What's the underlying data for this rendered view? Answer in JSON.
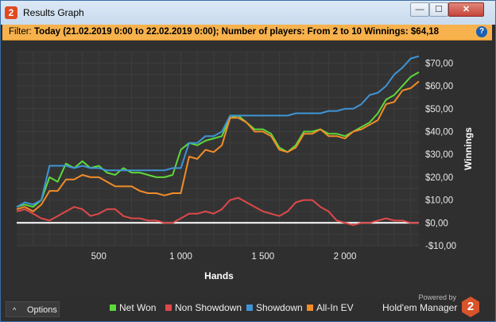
{
  "window": {
    "title": "Results Graph",
    "app_icon_label": "2",
    "minimize": "—",
    "maximize": "☐",
    "close": "✕"
  },
  "filter": {
    "label": "Filter:",
    "text": "Today (21.02.2019 0:00 to 22.02.2019 0:00); Number of players: From 2 to 10  Winnings: $64,18",
    "help": "?"
  },
  "chart_data": {
    "type": "line",
    "xlabel": "Hands",
    "ylabel": "Winnings",
    "xlim": [
      0,
      2450
    ],
    "ylim": [
      -10,
      75
    ],
    "x_ticks": [
      500,
      1000,
      1500,
      2000
    ],
    "x_tick_labels": [
      "500",
      "1 000",
      "1 500",
      "2 000"
    ],
    "y_ticks": [
      -10,
      0,
      10,
      20,
      30,
      40,
      50,
      60,
      70
    ],
    "y_tick_labels": [
      "-$10,00",
      "$0,00",
      "$10,00",
      "$20,00",
      "$30,00",
      "$40,00",
      "$50,00",
      "$60,00",
      "$70,00"
    ],
    "grid": true,
    "x": [
      0,
      50,
      100,
      150,
      200,
      250,
      300,
      350,
      400,
      450,
      500,
      550,
      600,
      650,
      700,
      750,
      800,
      850,
      900,
      950,
      1000,
      1050,
      1100,
      1150,
      1200,
      1250,
      1300,
      1350,
      1400,
      1450,
      1500,
      1550,
      1600,
      1650,
      1700,
      1750,
      1800,
      1850,
      1900,
      1950,
      2000,
      2050,
      2100,
      2150,
      2200,
      2250,
      2300,
      2350,
      2400,
      2450
    ],
    "series": [
      {
        "name": "Net Won",
        "color": "#5dd93a",
        "values": [
          7,
          8,
          7,
          10,
          20,
          18,
          26,
          24,
          27,
          24,
          25,
          22,
          21,
          24,
          22,
          22,
          21,
          20,
          20,
          21,
          32,
          35,
          34,
          36,
          37,
          38,
          46,
          47,
          44,
          41,
          41,
          39,
          33,
          31,
          34,
          40,
          40,
          41,
          39,
          39,
          38,
          40,
          42,
          44,
          48,
          54,
          56,
          60,
          64,
          66
        ]
      },
      {
        "name": "Non Showdown",
        "color": "#e0484a",
        "values": [
          5,
          6,
          4,
          2,
          1,
          3,
          5,
          7,
          6,
          3,
          4,
          6,
          6,
          3,
          2,
          2,
          1,
          1,
          0,
          0,
          2,
          4,
          4,
          5,
          4,
          6,
          10,
          11,
          9,
          7,
          5,
          4,
          3,
          5,
          9,
          10,
          10,
          7,
          5,
          1,
          0,
          -1,
          0,
          0,
          1,
          2,
          1,
          1,
          0,
          0
        ]
      },
      {
        "name": "Showdown",
        "color": "#3f94d6",
        "values": [
          7,
          9,
          8,
          10,
          25,
          25,
          25,
          24,
          25,
          24,
          24,
          23,
          23,
          23,
          23,
          23,
          23,
          23,
          23,
          24,
          24,
          35,
          35,
          38,
          38,
          40,
          47,
          47,
          47,
          47,
          47,
          47,
          47,
          47,
          48,
          48,
          48,
          48,
          49,
          49,
          50,
          50,
          52,
          56,
          57,
          60,
          65,
          68,
          72,
          73
        ]
      },
      {
        "name": "All-In EV",
        "color": "#f28c28",
        "values": [
          6,
          7,
          5,
          8,
          14,
          14,
          19,
          19,
          21,
          20,
          20,
          18,
          16,
          16,
          16,
          14,
          13,
          13,
          12,
          13,
          13,
          29,
          28,
          32,
          31,
          34,
          46,
          46,
          44,
          40,
          40,
          38,
          32,
          31,
          33,
          39,
          39,
          41,
          38,
          38,
          37,
          40,
          41,
          43,
          45,
          52,
          53,
          58,
          59,
          62
        ]
      }
    ],
    "zero_line": true
  },
  "bottom": {
    "options_caret": "^",
    "options_label": "Options",
    "powered_by": "Powered by",
    "brand": "Hold'em Manager",
    "brand_logo": "2",
    "legend": [
      {
        "label": "Net Won",
        "color": "#5dd93a"
      },
      {
        "label": "Non Showdown",
        "color": "#e0484a"
      },
      {
        "label": "Showdown",
        "color": "#3f94d6"
      },
      {
        "label": "All-In EV",
        "color": "#f28c28"
      }
    ]
  }
}
